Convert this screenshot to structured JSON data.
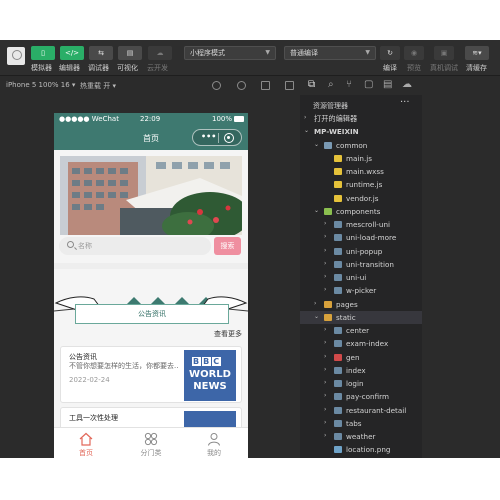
{
  "toolbar": {
    "buttons": [
      {
        "label": "模拟器",
        "icon": "phone-icon"
      },
      {
        "label": "编辑器",
        "icon": "code-icon"
      },
      {
        "label": "调试器",
        "icon": "debug-icon"
      },
      {
        "label": "可视化",
        "icon": "visual-icon"
      },
      {
        "label": "云开发",
        "icon": "cloud-icon"
      }
    ],
    "mode_select": "小程序模式",
    "compile_select": "普通编译",
    "right_labels": [
      "编译",
      "预览",
      "真机调试",
      "清缓存"
    ]
  },
  "subbar": {
    "device": "iPhone 5 100% 16 ▾",
    "reload": "热重载 开 ▾"
  },
  "phone": {
    "status": {
      "carrier": "●●●●● WeChat",
      "time": "22:09",
      "battery": "100%"
    },
    "nav_title": "首页",
    "search_placeholder": "名称",
    "search_button": "搜索",
    "notice_title": "公告资讯",
    "more_link": "查看更多",
    "cards": [
      {
        "title": "公告资讯",
        "desc": "不管你想要怎样的生活，你都要去...",
        "date": "2022-02-24"
      },
      {
        "title": "工具一次性处理",
        "desc": "",
        "date": ""
      }
    ],
    "bbc": {
      "logo": "BBC",
      "line1": "WORLD",
      "line2": "NEWS"
    },
    "tabs": [
      {
        "label": "首页",
        "active": true
      },
      {
        "label": "分门类",
        "active": false
      },
      {
        "label": "我的",
        "active": false
      }
    ]
  },
  "explorer": {
    "title": "资源管理器",
    "items": [
      {
        "label": "打开的编辑器",
        "level": 0,
        "chev": "›",
        "type": "none"
      },
      {
        "label": "MP-WEIXIN",
        "level": 0,
        "chev": "⌄",
        "type": "none",
        "bold": true
      },
      {
        "label": "common",
        "level": 1,
        "chev": "⌄",
        "type": "folder-open"
      },
      {
        "label": "main.js",
        "level": 2,
        "chev": "",
        "type": "js"
      },
      {
        "label": "main.wxss",
        "level": 2,
        "chev": "",
        "type": "css"
      },
      {
        "label": "runtime.js",
        "level": 2,
        "chev": "",
        "type": "js"
      },
      {
        "label": "vendor.js",
        "level": 2,
        "chev": "",
        "type": "js"
      },
      {
        "label": "components",
        "level": 1,
        "chev": "⌄",
        "type": "folder-green"
      },
      {
        "label": "mescroll-uni",
        "level": 2,
        "chev": "›",
        "type": "folder"
      },
      {
        "label": "uni-load-more",
        "level": 2,
        "chev": "›",
        "type": "folder"
      },
      {
        "label": "uni-popup",
        "level": 2,
        "chev": "›",
        "type": "folder"
      },
      {
        "label": "uni-transition",
        "level": 2,
        "chev": "›",
        "type": "folder"
      },
      {
        "label": "uni-ui",
        "level": 2,
        "chev": "›",
        "type": "folder"
      },
      {
        "label": "w-picker",
        "level": 2,
        "chev": "›",
        "type": "folder"
      },
      {
        "label": "pages",
        "level": 1,
        "chev": "›",
        "type": "folder-orange"
      },
      {
        "label": "static",
        "level": 1,
        "chev": "⌄",
        "type": "folder-orange",
        "selected": true
      },
      {
        "label": "center",
        "level": 2,
        "chev": "›",
        "type": "folder"
      },
      {
        "label": "exam-index",
        "level": 2,
        "chev": "›",
        "type": "folder"
      },
      {
        "label": "gen",
        "level": 2,
        "chev": "›",
        "type": "folder-red"
      },
      {
        "label": "index",
        "level": 2,
        "chev": "›",
        "type": "folder"
      },
      {
        "label": "login",
        "level": 2,
        "chev": "›",
        "type": "folder"
      },
      {
        "label": "pay-confirm",
        "level": 2,
        "chev": "›",
        "type": "folder"
      },
      {
        "label": "restaurant-detail",
        "level": 2,
        "chev": "›",
        "type": "folder"
      },
      {
        "label": "tabs",
        "level": 2,
        "chev": "›",
        "type": "folder"
      },
      {
        "label": "weather",
        "level": 2,
        "chev": "›",
        "type": "folder"
      },
      {
        "label": "location.png",
        "level": 2,
        "chev": "",
        "type": "image"
      }
    ]
  },
  "colors": {
    "accent_green": "#2aae67",
    "nav_teal": "#3e7970",
    "search_pink": "#ef8fa0",
    "tab_active": "#e2685a",
    "bbc_blue": "#3d66a8"
  }
}
